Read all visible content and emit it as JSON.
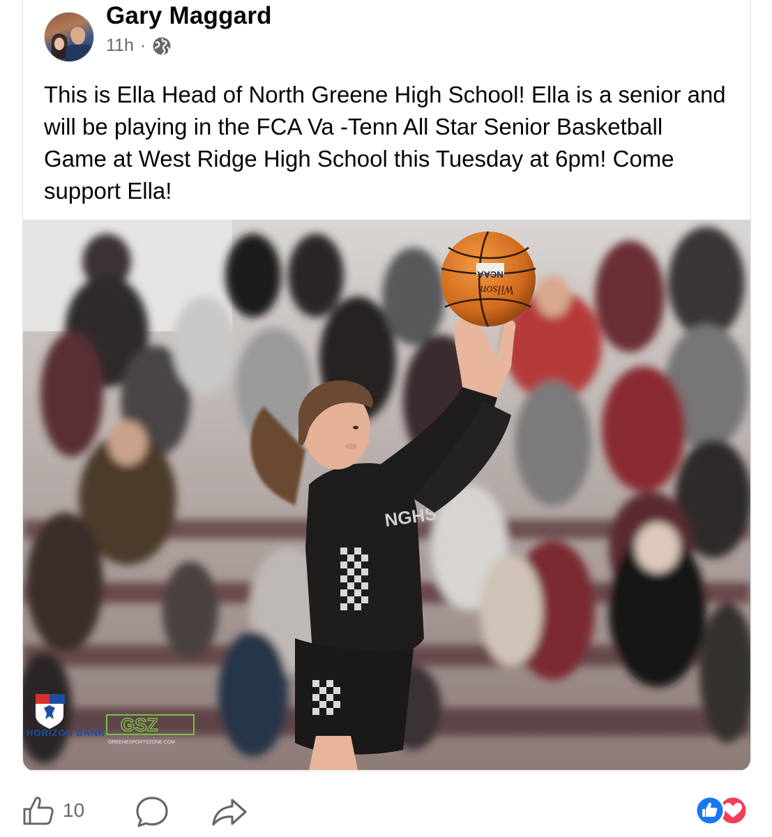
{
  "post": {
    "author": "Gary Maggard",
    "time": "11h",
    "separator": "·",
    "text": "This is Ella Head of North Greene High School! Ella is a senior and will be playing in the FCA Va -Tenn All Star Senior Basketball Game at West Ridge High School this Tuesday at 6pm! Come support Ella!"
  },
  "photo": {
    "logo_sponsor": "FIRST HORIZON BANK",
    "logo_site_mark": "GSZ",
    "logo_site_url": "GREENESPORTSZONE.COM",
    "ball_brand": "Wilson",
    "ball_mark": "NCAA",
    "jersey_text": "NGHS"
  },
  "actions": {
    "like_count": "10"
  },
  "icons": {
    "privacy": "globe-icon",
    "like": "thumbs-up-icon",
    "comment": "comment-icon",
    "share": "share-icon",
    "reaction_like": "like-reaction-icon",
    "reaction_love": "love-reaction-icon"
  },
  "colors": {
    "name": "#050505",
    "meta": "#65676b",
    "like_blue": "#1877f2",
    "love_red": "#f33e58"
  }
}
